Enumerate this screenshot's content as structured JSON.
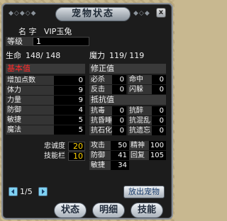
{
  "title": "宠物状态",
  "close_label": "x",
  "name_label": "名  字",
  "name_value": "VIP玉兔",
  "level_label": "等级",
  "level_value": "1",
  "hp_label": "生命",
  "hp_value": "148/ 148",
  "mp_label": "魔力",
  "mp_value": "119/ 119",
  "basic_header": "基本值",
  "modifier_header": "修正值",
  "resist_header": "抵抗值",
  "basic_stats": [
    {
      "label": "增加点数",
      "value": "0"
    },
    {
      "label": "体力",
      "value": "9"
    },
    {
      "label": "力量",
      "value": "9"
    },
    {
      "label": "防御",
      "value": "4"
    },
    {
      "label": "敏捷",
      "value": "5"
    },
    {
      "label": "魔法",
      "value": "5"
    }
  ],
  "modifiers": [
    {
      "l1": "必杀",
      "v1": "0",
      "l2": "命中",
      "v2": "0"
    },
    {
      "l1": "反击",
      "v1": "0",
      "l2": "闪躲",
      "v2": "0"
    }
  ],
  "resists": [
    {
      "l1": "抗毒",
      "v1": "0",
      "l2": "抗醉",
      "v2": "0"
    },
    {
      "l1": "抗昏睡",
      "v1": "0",
      "l2": "抗混乱",
      "v2": "0"
    },
    {
      "l1": "抗石化",
      "v1": "0",
      "l2": "抗遗忘",
      "v2": "0"
    }
  ],
  "loyalty_label": "忠诚度",
  "loyalty_value": "20",
  "skill_slots_label": "技能栏",
  "skill_slots_value": "10",
  "combat": [
    {
      "l1": "攻击",
      "v1": "50",
      "l2": "精神",
      "v2": "100"
    },
    {
      "l1": "防御",
      "v1": "41",
      "l2": "回复",
      "v2": "105"
    },
    {
      "l1": "敏捷",
      "v1": "34"
    }
  ],
  "page_indicator": "1/5",
  "release_button": "放出宠物",
  "tabs": [
    "状态",
    "明细",
    "技能"
  ],
  "colors": {
    "red_label": "#ff2a2a",
    "yellow_value": "#ffd400",
    "panel_bg": "#1c1c1c"
  }
}
